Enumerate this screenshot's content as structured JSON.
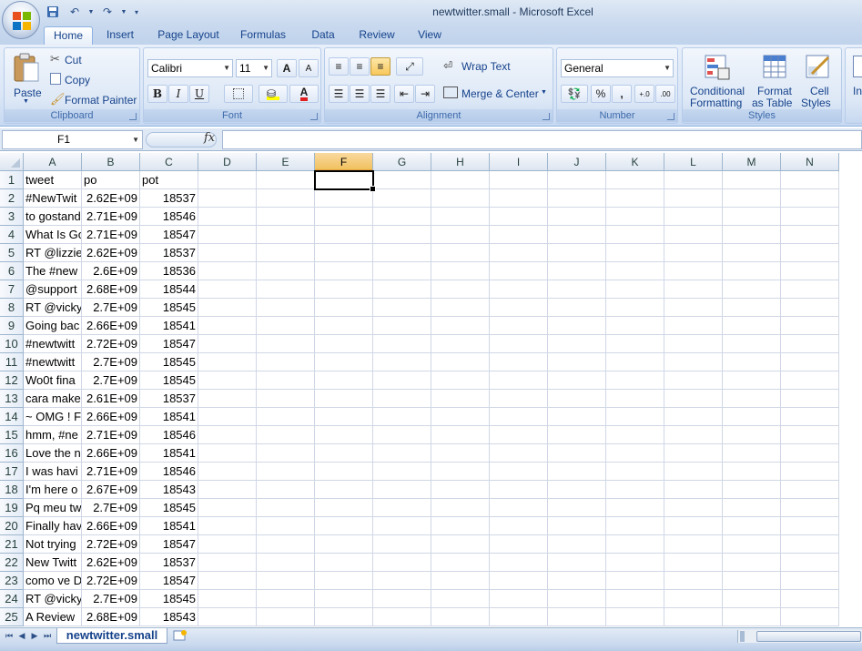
{
  "window": {
    "title": "newtwitter.small  -  Microsoft Excel"
  },
  "tabs": [
    "Home",
    "Insert",
    "Page Layout",
    "Formulas",
    "Data",
    "Review",
    "View"
  ],
  "ribbon": {
    "clipboard": {
      "label": "Clipboard",
      "paste": "Paste",
      "cut": "Cut",
      "copy": "Copy",
      "format_painter": "Format Painter"
    },
    "font": {
      "label": "Font",
      "font_name": "Calibri",
      "font_size": "11",
      "bold": "B",
      "italic": "I",
      "underline": "U",
      "grow": "A",
      "shrink": "A",
      "font_color": "A"
    },
    "alignment": {
      "label": "Alignment",
      "wrap_text": "Wrap Text",
      "merge_center": "Merge & Center"
    },
    "number": {
      "label": "Number",
      "format": "General",
      "percent": "%",
      "comma": ",",
      "inc_decimal": "+.0",
      "dec_decimal": ".00"
    },
    "styles": {
      "label": "Styles",
      "conditional_1": "Conditional",
      "conditional_2": "Formatting",
      "format_table_1": "Format",
      "format_table_2": "as Table",
      "cell_styles_1": "Cell",
      "cell_styles_2": "Styles"
    },
    "cells": {
      "insert_partial": "In"
    }
  },
  "formula_bar": {
    "name_box": "F1",
    "fx": "fx",
    "content": ""
  },
  "grid": {
    "columns": [
      "A",
      "B",
      "C",
      "D",
      "E",
      "F",
      "G",
      "H",
      "I",
      "J",
      "K",
      "L",
      "M",
      "N"
    ],
    "selected_column": "F",
    "rows": [
      {
        "num": "1",
        "a": "tweet",
        "b": "po",
        "c": "pot"
      },
      {
        "num": "2",
        "a": "#NewTwit",
        "b": "2.62E+09",
        "c": "18537"
      },
      {
        "num": "3",
        "a": "to gostand",
        "b": "2.71E+09",
        "c": "18546"
      },
      {
        "num": "4",
        "a": "What Is Go",
        "b": "2.71E+09",
        "c": "18547"
      },
      {
        "num": "5",
        "a": "RT @lizzie",
        "b": "2.62E+09",
        "c": "18537"
      },
      {
        "num": "6",
        "a": "The #new",
        "b": "2.6E+09",
        "c": "18536"
      },
      {
        "num": "7",
        "a": "@support",
        "b": "2.68E+09",
        "c": "18544"
      },
      {
        "num": "8",
        "a": "RT @vicky",
        "b": "2.7E+09",
        "c": "18545"
      },
      {
        "num": "9",
        "a": "Going bac",
        "b": "2.66E+09",
        "c": "18541"
      },
      {
        "num": "10",
        "a": "#newtwitt",
        "b": "2.72E+09",
        "c": "18547"
      },
      {
        "num": "11",
        "a": "#newtwitt",
        "b": "2.7E+09",
        "c": "18545"
      },
      {
        "num": "12",
        "a": "Wo0t fina",
        "b": "2.7E+09",
        "c": "18545"
      },
      {
        "num": "13",
        "a": "cara make",
        "b": "2.61E+09",
        "c": "18537"
      },
      {
        "num": "14",
        "a": "~ OMG ! Fi",
        "b": "2.66E+09",
        "c": "18541"
      },
      {
        "num": "15",
        "a": "hmm, #ne",
        "b": "2.71E+09",
        "c": "18546"
      },
      {
        "num": "16",
        "a": "Love the n",
        "b": "2.66E+09",
        "c": "18541"
      },
      {
        "num": "17",
        "a": "I was havi",
        "b": "2.71E+09",
        "c": "18546"
      },
      {
        "num": "18",
        "a": "I'm here o",
        "b": "2.67E+09",
        "c": "18543"
      },
      {
        "num": "19",
        "a": "Pq meu tw",
        "b": "2.7E+09",
        "c": "18545"
      },
      {
        "num": "20",
        "a": "Finally hav",
        "b": "2.66E+09",
        "c": "18541"
      },
      {
        "num": "21",
        "a": "Not trying",
        "b": "2.72E+09",
        "c": "18547"
      },
      {
        "num": "22",
        "a": "New Twitt",
        "b": "2.62E+09",
        "c": "18537"
      },
      {
        "num": "23",
        "a": "como ve D",
        "b": "2.72E+09",
        "c": "18547"
      },
      {
        "num": "24",
        "a": "RT @vicky",
        "b": "2.7E+09",
        "c": "18545"
      },
      {
        "num": "25",
        "a": "A Review",
        "b": "2.68E+09",
        "c": "18543"
      }
    ]
  },
  "sheets": {
    "active": "newtwitter.small"
  },
  "colors": {
    "ribbon_bg": "#dbe7f7",
    "selected_header": "#f1c15f",
    "gridline": "#d0d7e5",
    "text_blue": "#15428b"
  }
}
